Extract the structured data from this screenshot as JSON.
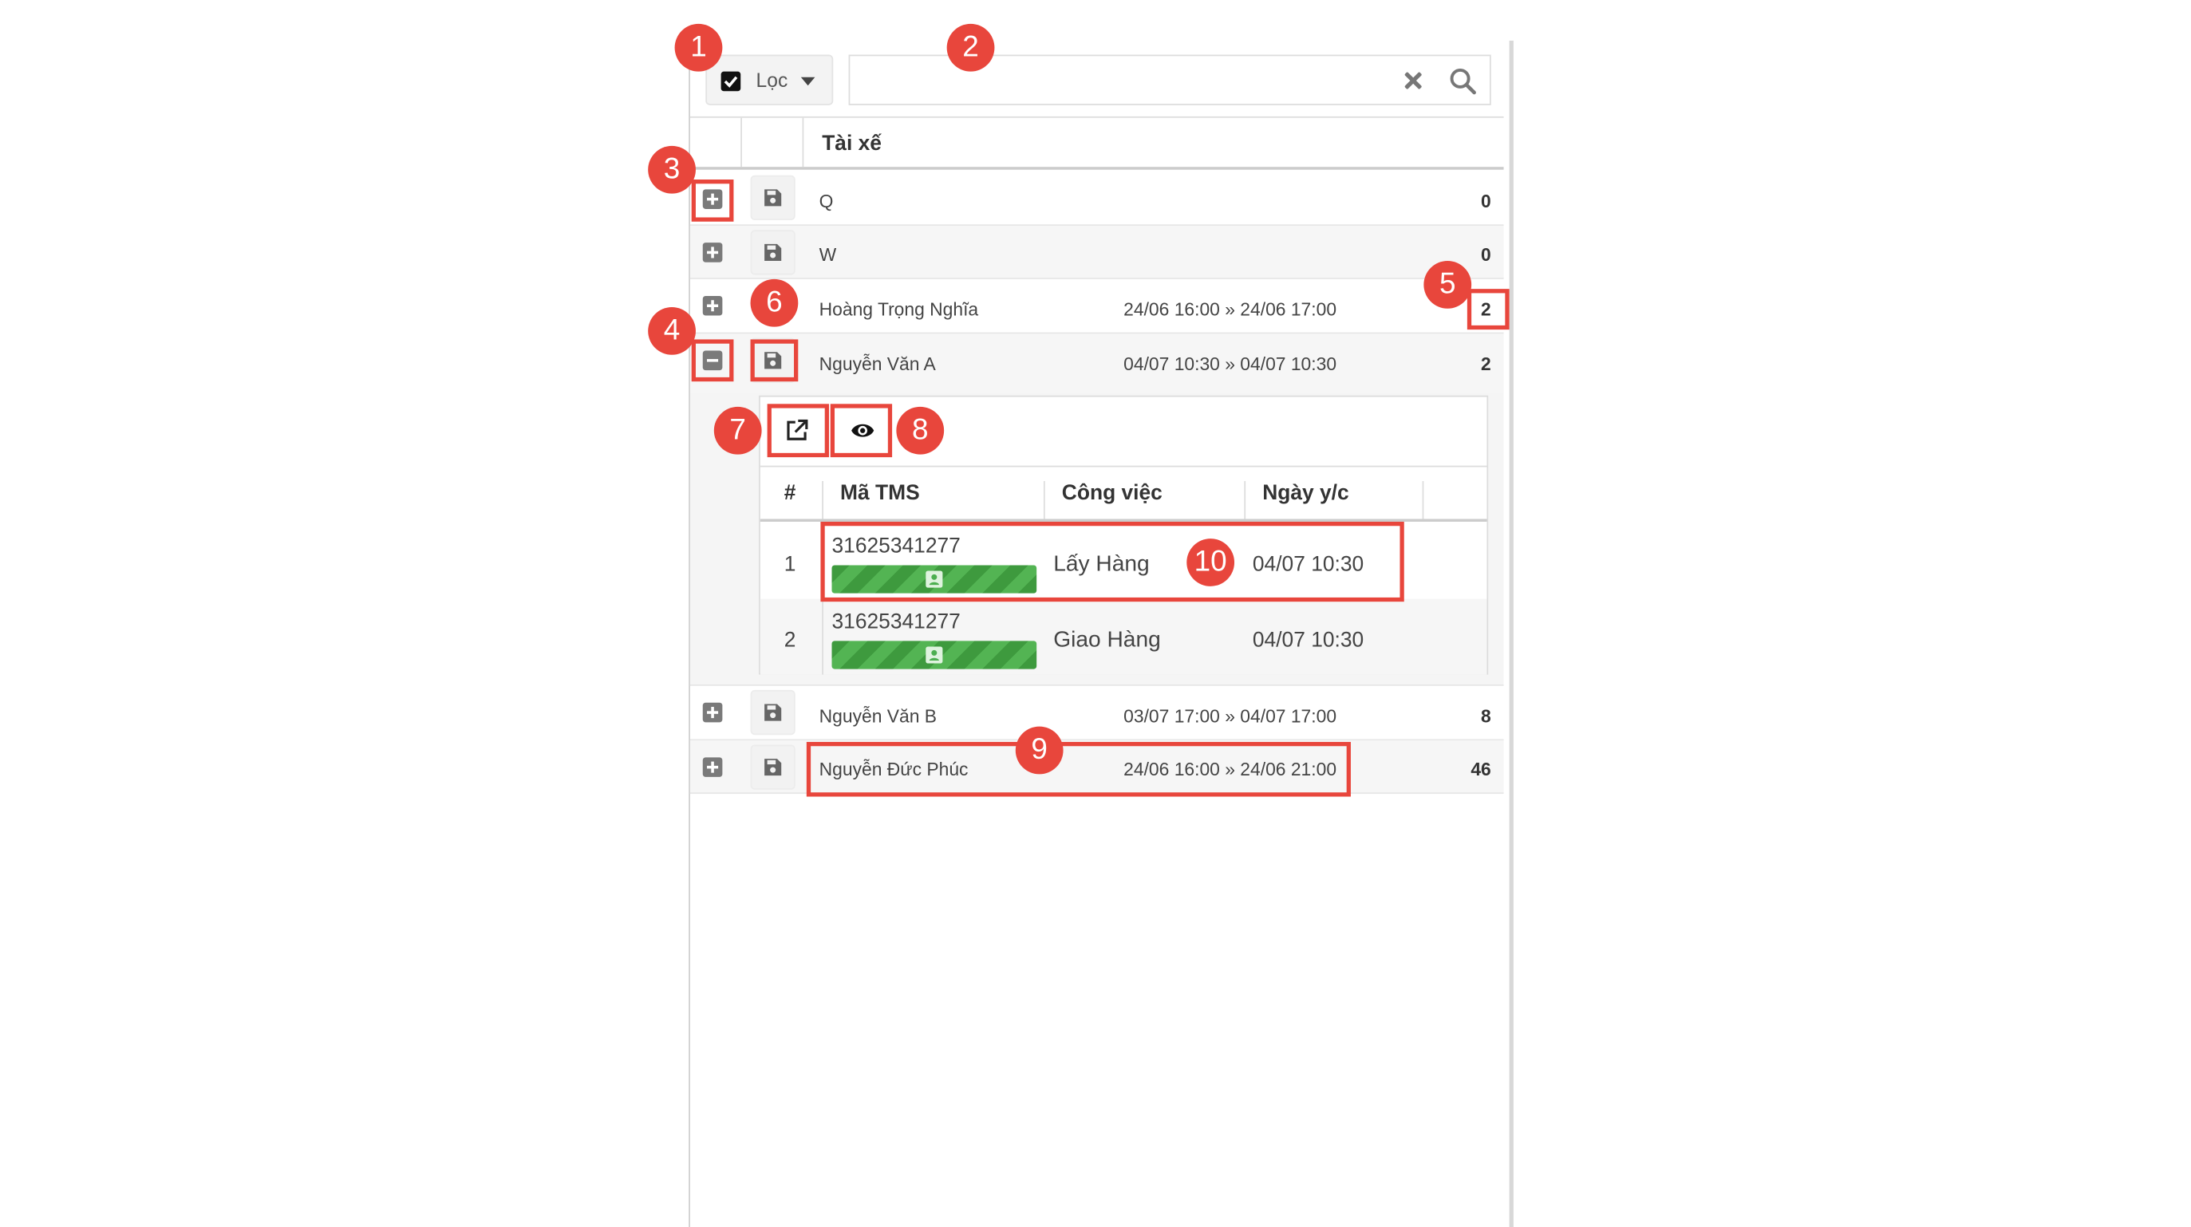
{
  "filter": {
    "label": "Lọc",
    "checked": true
  },
  "search": {
    "value": "",
    "placeholder": ""
  },
  "table": {
    "header": "Tài xế"
  },
  "drivers": [
    {
      "name": "Q",
      "range": "",
      "count": "0",
      "expanded": false
    },
    {
      "name": "W",
      "range": "",
      "count": "0",
      "expanded": false
    },
    {
      "name": "Hoàng Trọng Nghĩa",
      "range": "24/06 16:00 » 24/06 17:00",
      "count": "2",
      "expanded": false
    },
    {
      "name": "Nguyễn Văn A",
      "range": "04/07 10:30 » 04/07 10:30",
      "count": "2",
      "expanded": true
    },
    {
      "name": "Nguyễn Văn B",
      "range": "03/07 17:00 » 04/07 17:00",
      "count": "8",
      "expanded": false
    },
    {
      "name": "Nguyễn Đức Phúc",
      "range": "24/06 16:00 » 24/06 21:00",
      "count": "46",
      "expanded": false
    }
  ],
  "orders": {
    "columns": {
      "index": "#",
      "tms": "Mã TMS",
      "job": "Công việc",
      "date": "Ngày y/c"
    },
    "rows": [
      {
        "index": "1",
        "tms": "31625341277",
        "job": "Lấy Hàng",
        "date": "04/07 10:30"
      },
      {
        "index": "2",
        "tms": "31625341277",
        "job": "Giao Hàng",
        "date": "04/07 10:30"
      }
    ]
  },
  "callouts": [
    "1",
    "2",
    "3",
    "4",
    "5",
    "6",
    "7",
    "8",
    "9",
    "10"
  ],
  "colors": {
    "accent": "#e8463c",
    "badge_green": "#4caf50",
    "icon_gray": "#7a7a7a"
  }
}
